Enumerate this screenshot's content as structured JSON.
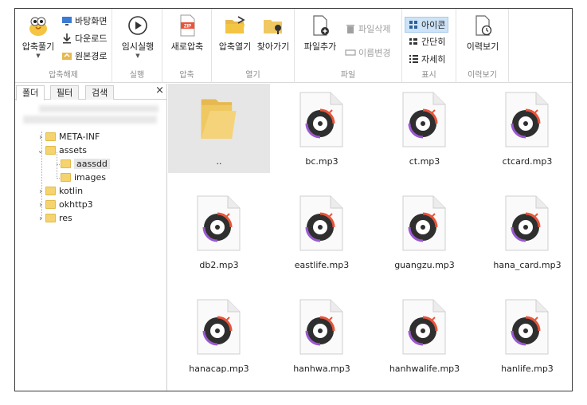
{
  "ribbon": {
    "groups": [
      {
        "label": "압축해제",
        "extract": "압축풀기",
        "desktop": "바탕화면",
        "download": "다운로드",
        "origin": "원본경로"
      },
      {
        "label": "실행",
        "temp_run": "임시실행"
      },
      {
        "label": "압축",
        "new_zip": "새로압축"
      },
      {
        "label": "열기",
        "open_zip": "압축열기",
        "browse": "찾아가기"
      },
      {
        "label": "파일",
        "add_file": "파일추가",
        "delete_file": "파일삭제",
        "rename": "이름변경"
      },
      {
        "label": "표시",
        "icons": "아이콘",
        "simple": "간단히",
        "details": "자세히"
      },
      {
        "label": "이력보기",
        "history": "이력보기"
      }
    ],
    "zip_badge": "ZIP"
  },
  "left": {
    "tabs": [
      "폴더",
      "필터",
      "검색"
    ],
    "close": "×",
    "tree": [
      {
        "label": "META-INF",
        "chev": "›"
      },
      {
        "label": "assets",
        "chev": "⌄"
      },
      {
        "label": "aassdd",
        "chev": ""
      },
      {
        "label": "images",
        "chev": ""
      },
      {
        "label": "kotlin",
        "chev": "›"
      },
      {
        "label": "okhttp3",
        "chev": "›"
      },
      {
        "label": "res",
        "chev": "›"
      }
    ]
  },
  "files": [
    {
      "name": "..",
      "kind": "folder"
    },
    {
      "name": "bc.mp3",
      "kind": "mp3"
    },
    {
      "name": "ct.mp3",
      "kind": "mp3"
    },
    {
      "name": "ctcard.mp3",
      "kind": "mp3"
    },
    {
      "name": "db2.mp3",
      "kind": "mp3"
    },
    {
      "name": "eastlife.mp3",
      "kind": "mp3"
    },
    {
      "name": "guangzu.mp3",
      "kind": "mp3"
    },
    {
      "name": "hana_card.mp3",
      "kind": "mp3"
    },
    {
      "name": "hanacap.mp3",
      "kind": "mp3"
    },
    {
      "name": "hanhwa.mp3",
      "kind": "mp3"
    },
    {
      "name": "hanhwalife.mp3",
      "kind": "mp3"
    },
    {
      "name": "hanlife.mp3",
      "kind": "mp3"
    }
  ],
  "colors": {
    "accent": "#e8553b",
    "folder": "#f0c862",
    "selection": "#cde3f7"
  }
}
